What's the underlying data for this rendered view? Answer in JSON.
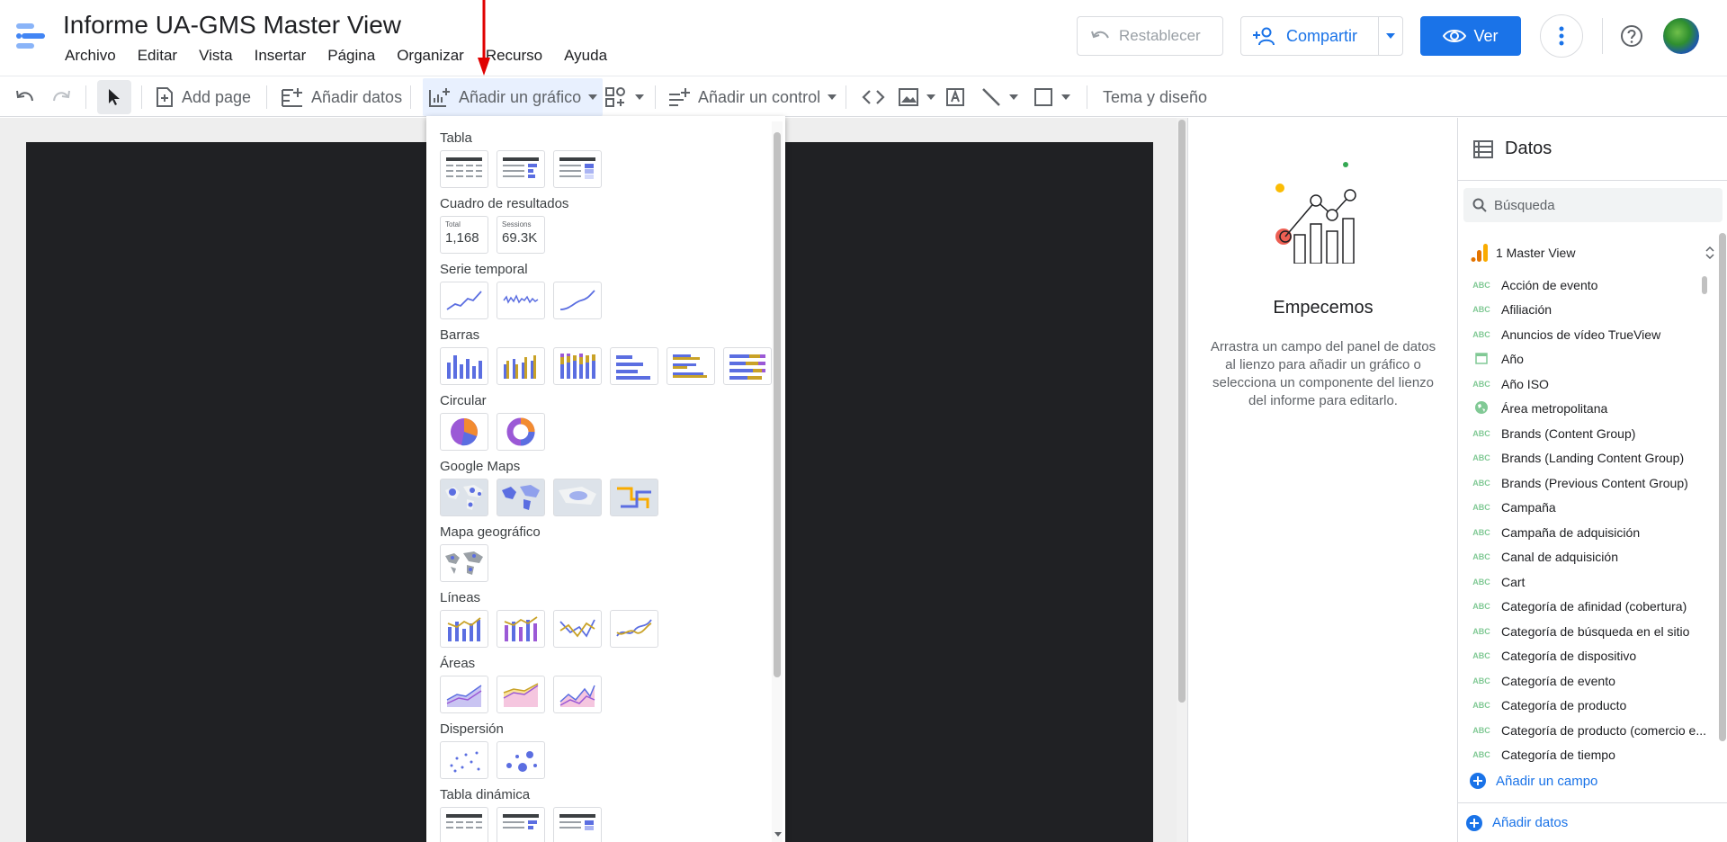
{
  "header": {
    "title": "Informe UA-GMS Master View",
    "menu": [
      "Archivo",
      "Editar",
      "Vista",
      "Insertar",
      "Página",
      "Organizar",
      "Recurso",
      "Ayuda"
    ],
    "reset_label": "Restablecer",
    "share_label": "Compartir",
    "view_label": "Ver"
  },
  "toolbar": {
    "add_page": "Add page",
    "add_data": "Añadir datos",
    "add_chart": "Añadir un gráfico",
    "add_control": "Añadir un control",
    "theme": "Tema y diseño"
  },
  "chart_menu": {
    "sections": [
      "Tabla",
      "Cuadro de resultados",
      "Serie temporal",
      "Barras",
      "Circular",
      "Google Maps",
      "Mapa geográfico",
      "Líneas",
      "Áreas",
      "Dispersión",
      "Tabla dinámica"
    ],
    "scorecards": [
      {
        "label": "Total",
        "value": "1,168"
      },
      {
        "label": "Sessions",
        "value": "69.3K"
      }
    ]
  },
  "properties": {
    "title": "Empecemos",
    "description": "Arrastra un campo del panel de datos al lienzo para añadir un gráfico o selecciona un componente del lienzo del informe para editarlo."
  },
  "data_panel": {
    "title": "Datos",
    "search_placeholder": "Búsqueda",
    "source": "1 Master View",
    "fields": [
      {
        "type": "ABC",
        "label": "Acción de evento"
      },
      {
        "type": "ABC",
        "label": "Afiliación"
      },
      {
        "type": "ABC",
        "label": "Anuncios de vídeo TrueView"
      },
      {
        "type": "date",
        "label": "Año"
      },
      {
        "type": "ABC",
        "label": "Año ISO"
      },
      {
        "type": "geo",
        "label": "Área metropolitana"
      },
      {
        "type": "ABC",
        "label": "Brands (Content Group)"
      },
      {
        "type": "ABC",
        "label": "Brands (Landing Content Group)"
      },
      {
        "type": "ABC",
        "label": "Brands (Previous Content Group)"
      },
      {
        "type": "ABC",
        "label": "Campaña"
      },
      {
        "type": "ABC",
        "label": "Campaña de adquisición"
      },
      {
        "type": "ABC",
        "label": "Canal de adquisición"
      },
      {
        "type": "ABC",
        "label": "Cart"
      },
      {
        "type": "ABC",
        "label": "Categoría de afinidad (cobertura)"
      },
      {
        "type": "ABC",
        "label": "Categoría de búsqueda en el sitio"
      },
      {
        "type": "ABC",
        "label": "Categoría de dispositivo"
      },
      {
        "type": "ABC",
        "label": "Categoría de evento"
      },
      {
        "type": "ABC",
        "label": "Categoría de producto"
      },
      {
        "type": "ABC",
        "label": "Categoría de producto (comercio e..."
      },
      {
        "type": "ABC",
        "label": "Categoría de tiempo"
      }
    ],
    "add_field": "Añadir un campo",
    "add_data": "Añadir datos"
  },
  "colors": {
    "accent": "#1a73e8",
    "canvas": "#202124",
    "chart_blue": "#5b6ee1",
    "chart_gold": "#c9a227",
    "chart_purple": "#9b59d6"
  }
}
